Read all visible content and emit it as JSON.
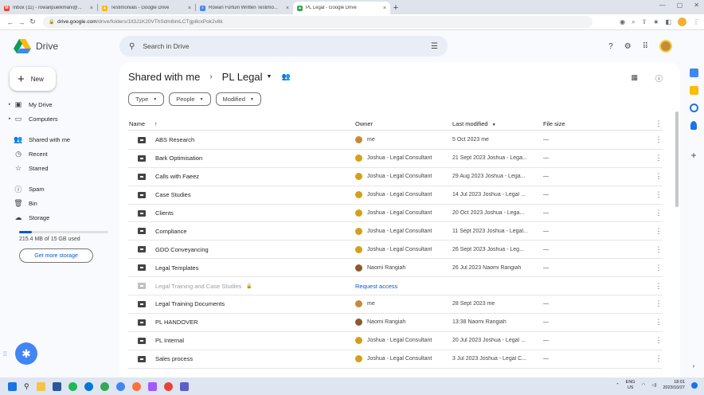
{
  "browser": {
    "tabs": [
      {
        "title": "Inbox (11) - rowanpuelkmani@...",
        "color": "#ea4335",
        "glyph": "M",
        "active": false
      },
      {
        "title": "Testimonials - Google Drive",
        "color": "#fbbc04",
        "glyph": "▲",
        "active": false
      },
      {
        "title": "Rowan Fortuin Written Testimo...",
        "color": "#4285f4",
        "glyph": "≡",
        "active": false
      },
      {
        "title": "PL Legal - Google Drive",
        "color": "#34a853",
        "glyph": "▲",
        "active": true
      }
    ],
    "url_domain": "drive.google.com",
    "url_path": "/drive/folders/1lt3J1K20VThSdm6imLCTgp8cxPok2v8k"
  },
  "header": {
    "app_name": "Drive",
    "search_placeholder": "Search in Drive"
  },
  "sidebar": {
    "new_label": "New",
    "items": [
      {
        "label": "My Drive",
        "icon": "my-drive-icon",
        "glyph": "▣",
        "expandable": true
      },
      {
        "label": "Computers",
        "icon": "computers-icon",
        "glyph": "▭",
        "expandable": true
      },
      {
        "label": "Shared with me",
        "icon": "shared-icon",
        "glyph": "👥",
        "expandable": false
      },
      {
        "label": "Recent",
        "icon": "clock-icon",
        "glyph": "◷",
        "expandable": false
      },
      {
        "label": "Starred",
        "icon": "star-icon",
        "glyph": "☆",
        "expandable": false
      },
      {
        "label": "Spam",
        "icon": "spam-icon",
        "glyph": "ⓘ",
        "expandable": false
      },
      {
        "label": "Bin",
        "icon": "bin-icon",
        "glyph": "🗑",
        "expandable": false
      },
      {
        "label": "Storage",
        "icon": "cloud-icon",
        "glyph": "☁",
        "expandable": false
      }
    ],
    "storage_used_fraction": 0.14,
    "storage_text": "215.4 MB of 15 GB used",
    "get_storage_label": "Get more storage"
  },
  "main": {
    "breadcrumb_root": "Shared with me",
    "breadcrumb_current": "PL Legal",
    "filters": [
      "Type",
      "People",
      "Modified"
    ],
    "columns": {
      "name": "Name",
      "owner": "Owner",
      "modified": "Last modified",
      "size": "File size"
    },
    "rows": [
      {
        "name": "ABS Research",
        "owner": "me",
        "owner_color": "#c58b3a",
        "modified": "5 Oct 2023 me",
        "size": "—",
        "disabled": false
      },
      {
        "name": "Bark Optimisation",
        "owner": "Joshua - Legal Consultant",
        "owner_color": "#d4a017",
        "modified": "21 Sept 2023 Joshua - Lega...",
        "size": "—",
        "disabled": false
      },
      {
        "name": "Calls with Faeez",
        "owner": "Joshua - Legal Consultant",
        "owner_color": "#d4a017",
        "modified": "29 Aug 2023 Joshua - Lega...",
        "size": "—",
        "disabled": false
      },
      {
        "name": "Case Studies",
        "owner": "Joshua - Legal Consultant",
        "owner_color": "#d4a017",
        "modified": "14 Jul 2023 Joshua - Legal ...",
        "size": "—",
        "disabled": false
      },
      {
        "name": "Clients",
        "owner": "Joshua - Legal Consultant",
        "owner_color": "#d4a017",
        "modified": "20 Oct 2023 Joshua - Lega...",
        "size": "—",
        "disabled": false
      },
      {
        "name": "Compliance",
        "owner": "Joshua - Legal Consultant",
        "owner_color": "#d4a017",
        "modified": "11 Sept 2023 Joshua - Legal...",
        "size": "—",
        "disabled": false
      },
      {
        "name": "GDO Conveyancing",
        "owner": "Joshua - Legal Consultant",
        "owner_color": "#d4a017",
        "modified": "26 Sept 2023 Joshua - Leg...",
        "size": "—",
        "disabled": false
      },
      {
        "name": "Legal Templates",
        "owner": "Naomi Rangiah",
        "owner_color": "#8d5a2b",
        "modified": "26 Jul 2023 Naomi Rangiah",
        "size": "—",
        "disabled": false
      },
      {
        "name": "Legal Training and Case Studies",
        "owner": "Request access",
        "owner_color": "",
        "modified": "",
        "size": "",
        "disabled": true
      },
      {
        "name": "Legal Training Documents",
        "owner": "me",
        "owner_color": "#c58b3a",
        "modified": "28 Sept 2023 me",
        "size": "—",
        "disabled": false
      },
      {
        "name": "PL HANDOVER",
        "owner": "Naomi Rangiah",
        "owner_color": "#8d5a2b",
        "modified": "13:38 Naomi Rangiah",
        "size": "—",
        "disabled": false
      },
      {
        "name": "PL Internal",
        "owner": "Joshua - Legal Consultant",
        "owner_color": "#d4a017",
        "modified": "20 Jul 2023 Joshua - Legal ...",
        "size": "—",
        "disabled": false
      },
      {
        "name": "Sales process",
        "owner": "Joshua - Legal Consultant",
        "owner_color": "#d4a017",
        "modified": "3 Jul 2023 Joshua - Legal C...",
        "size": "—",
        "disabled": false
      }
    ]
  },
  "taskbar": {
    "lang_top": "ENG",
    "lang_bottom": "US",
    "time": "18:01",
    "date": "2023/10/27"
  }
}
